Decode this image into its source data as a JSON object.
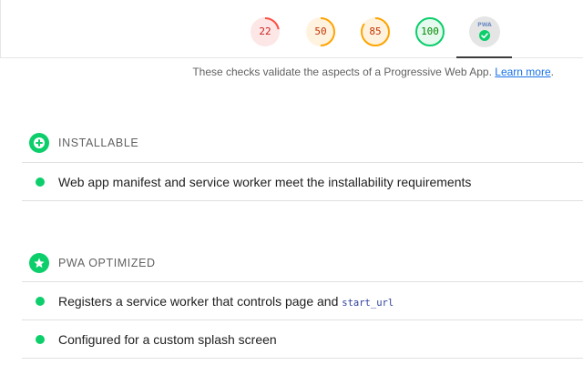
{
  "gauges": [
    {
      "name": "performance",
      "value": "22",
      "score": 0.22,
      "color": "#ff4e42",
      "bg": "#fde7e6"
    },
    {
      "name": "accessibility",
      "value": "50",
      "score": 0.5,
      "color": "#ffa400",
      "bg": "#fff3e0"
    },
    {
      "name": "best-practices",
      "value": "85",
      "score": 0.85,
      "color": "#ffa400",
      "bg": "#fff3e0"
    },
    {
      "name": "seo",
      "value": "100",
      "score": 1.0,
      "color": "#0cce6b",
      "bg": "#e6f9ef"
    }
  ],
  "pwa_badge": {
    "label": "PWA"
  },
  "description": {
    "text": "These checks validate the aspects of a Progressive Web App. ",
    "link": "Learn more",
    "tail": "."
  },
  "groups": [
    {
      "title": "INSTALLABLE",
      "icon": "plus-circle-icon",
      "audits": [
        {
          "text": "Web app manifest and service worker meet the installability requirements"
        }
      ]
    },
    {
      "title": "PWA OPTIMIZED",
      "icon": "star-icon",
      "audits": [
        {
          "text": "Registers a service worker that controls page and ",
          "code": "start_url"
        },
        {
          "text": "Configured for a custom splash screen"
        }
      ]
    }
  ],
  "colors": {
    "pass": "#0cce6b",
    "link": "#1a73e8"
  }
}
